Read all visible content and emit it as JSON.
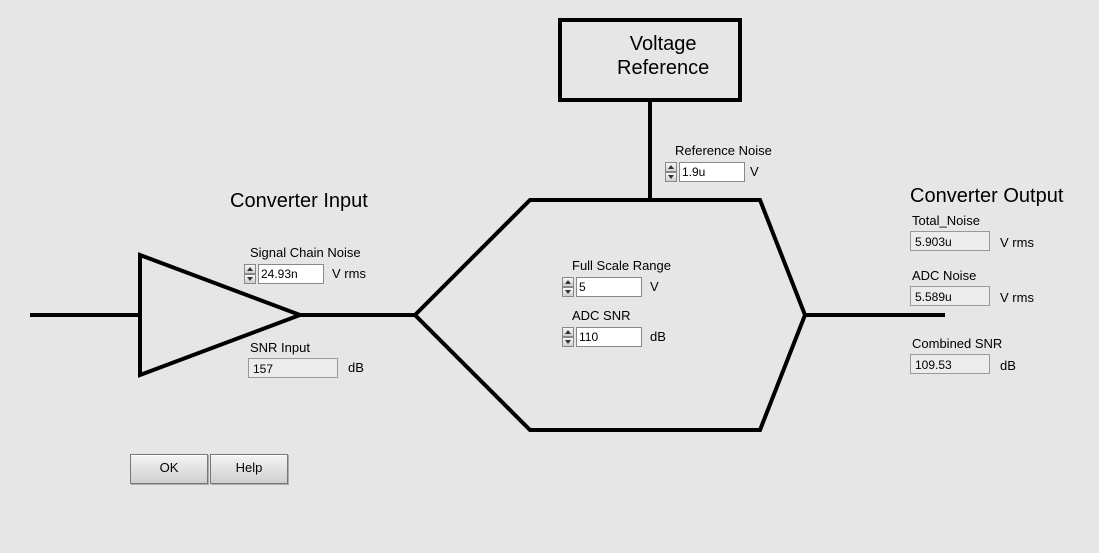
{
  "sections": {
    "voltage_reference_title": "Voltage\nReference",
    "converter_input_title": "Converter Input",
    "converter_output_title": "Converter Output"
  },
  "reference_noise": {
    "label": "Reference Noise",
    "value": "1.9u",
    "unit": "V"
  },
  "signal_chain_noise": {
    "label": "Signal Chain Noise",
    "value": "24.93n",
    "unit": "V rms"
  },
  "snr_input": {
    "label": "SNR Input",
    "value": "157",
    "unit": "dB"
  },
  "full_scale_range": {
    "label": "Full Scale Range",
    "value": "5",
    "unit": "V"
  },
  "adc_snr": {
    "label": "ADC SNR",
    "value": "110",
    "unit": "dB"
  },
  "total_noise": {
    "label": "Total_Noise",
    "value": "5.903u",
    "unit": "V rms"
  },
  "adc_noise": {
    "label": "ADC Noise",
    "value": "5.589u",
    "unit": "V rms"
  },
  "combined_snr": {
    "label": "Combined SNR",
    "value": "109.53",
    "unit": "dB"
  },
  "buttons": {
    "ok": "OK",
    "help": "Help"
  }
}
